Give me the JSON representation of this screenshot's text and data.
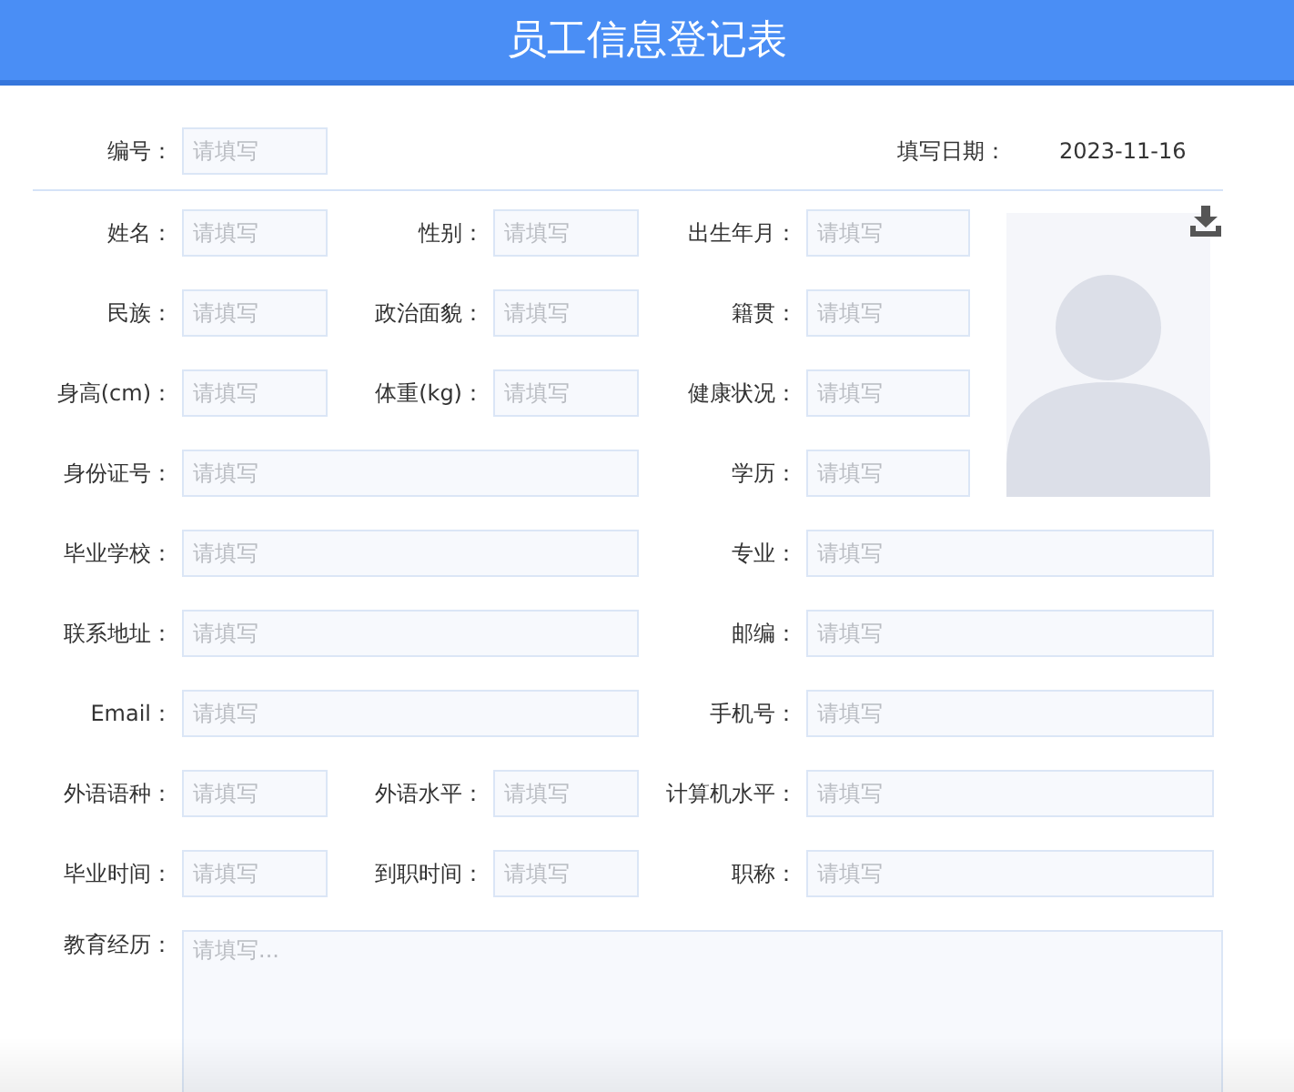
{
  "title": "员工信息登记表",
  "serial": {
    "label": "编号：",
    "placeholder": "请填写"
  },
  "date": {
    "label": "填写日期：",
    "value": "2023-11-16"
  },
  "rows": [
    [
      {
        "label": "姓名：",
        "placeholder": "请填写",
        "kind": "short"
      },
      {
        "label": "性别：",
        "placeholder": "请填写",
        "kind": "short"
      },
      {
        "label": "出生年月：",
        "placeholder": "请填写",
        "kind": "short"
      }
    ],
    [
      {
        "label": "民族：",
        "placeholder": "请填写",
        "kind": "short"
      },
      {
        "label": "政治面貌：",
        "placeholder": "请填写",
        "kind": "short"
      },
      {
        "label": "籍贯：",
        "placeholder": "请填写",
        "kind": "short"
      }
    ],
    [
      {
        "label": "身高(cm)：",
        "placeholder": "请填写",
        "kind": "short"
      },
      {
        "label": "体重(kg)：",
        "placeholder": "请填写",
        "kind": "short"
      },
      {
        "label": "健康状况：",
        "placeholder": "请填写",
        "kind": "short"
      }
    ],
    [
      {
        "label": "身份证号：",
        "placeholder": "请填写",
        "kind": "wide"
      },
      {
        "label": "学历：",
        "placeholder": "请填写",
        "kind": "short"
      }
    ],
    [
      {
        "label": "毕业学校：",
        "placeholder": "请填写",
        "kind": "wide"
      },
      {
        "label": "专业：",
        "placeholder": "请填写",
        "kind": "wide"
      }
    ],
    [
      {
        "label": "联系地址：",
        "placeholder": "请填写",
        "kind": "wide"
      },
      {
        "label": "邮编：",
        "placeholder": "请填写",
        "kind": "wide"
      }
    ],
    [
      {
        "label": "Email：",
        "placeholder": "请填写",
        "kind": "wide"
      },
      {
        "label": "手机号：",
        "placeholder": "请填写",
        "kind": "wide"
      }
    ],
    [
      {
        "label": "外语语种：",
        "placeholder": "请填写",
        "kind": "short"
      },
      {
        "label": "外语水平：",
        "placeholder": "请填写",
        "kind": "short"
      },
      {
        "label": "计算机水平：",
        "placeholder": "请填写",
        "kind": "wide"
      }
    ],
    [
      {
        "label": "毕业时间：",
        "placeholder": "请填写",
        "kind": "short"
      },
      {
        "label": "到职时间：",
        "placeholder": "请填写",
        "kind": "short"
      },
      {
        "label": "职称：",
        "placeholder": "请填写",
        "kind": "wide"
      }
    ]
  ],
  "education": {
    "label": "教育经历：",
    "placeholder": "请填写..."
  }
}
